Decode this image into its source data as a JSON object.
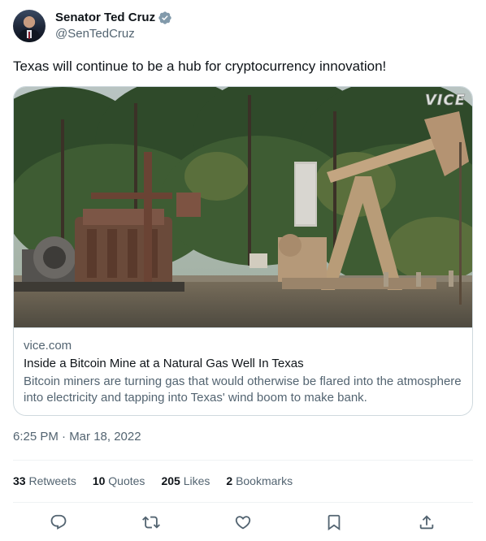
{
  "author": {
    "name": "Senator Ted Cruz",
    "handle": "@SenTedCruz",
    "verified": true,
    "avatar_icon": "avatar-portrait"
  },
  "tweet": {
    "text": "Texas will continue to be a hub for cryptocurrency innovation!"
  },
  "link_card": {
    "image_watermark": "VICE",
    "domain": "vice.com",
    "title": "Inside a Bitcoin Mine at a Natural Gas Well In Texas",
    "description": "Bitcoin miners are turning gas that would otherwise be flared into the atmosphere into electricity and tapping into Texas' wind boom to make bank."
  },
  "timestamp": "6:25 PM · Mar 18, 2022",
  "stats": [
    {
      "count": "33",
      "label": "Retweets"
    },
    {
      "count": "10",
      "label": "Quotes"
    },
    {
      "count": "205",
      "label": "Likes"
    },
    {
      "count": "2",
      "label": "Bookmarks"
    }
  ],
  "actions": [
    {
      "name": "reply",
      "icon": "reply-icon"
    },
    {
      "name": "retweet",
      "icon": "retweet-icon"
    },
    {
      "name": "like",
      "icon": "heart-icon"
    },
    {
      "name": "bookmark",
      "icon": "bookmark-icon"
    },
    {
      "name": "share",
      "icon": "share-icon"
    }
  ],
  "colors": {
    "text_primary": "#0f1419",
    "text_secondary": "#536471",
    "border": "#cfd9de",
    "verified_badge": "#829aab"
  }
}
